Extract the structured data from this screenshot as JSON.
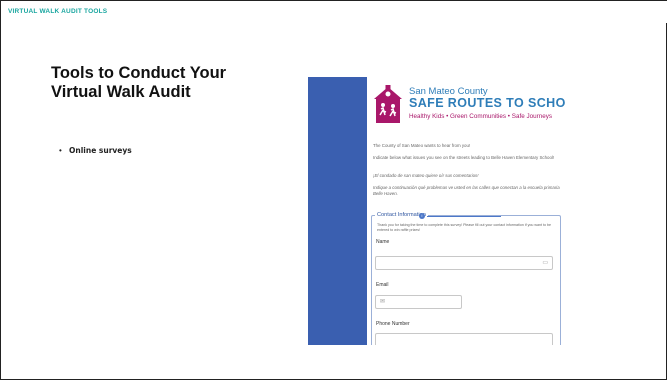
{
  "header": {
    "label": "VIRTUAL WALK AUDIT TOOLS"
  },
  "slide": {
    "title": "Tools to Conduct Your Virtual Walk Audit",
    "bullets": [
      {
        "marker": "•",
        "text": "Online surveys"
      }
    ]
  },
  "screenshot": {
    "brand": {
      "county": "San Mateo County",
      "program": "SAFE ROUTES TO SCHOOL",
      "tagline": "Healthy Kids • Green Communities • Safe Journeys"
    },
    "intro": [
      "The County of San Mateo wants to hear from you!",
      "Indicate below what issues you see on the streets leading to Belle Haven Elementary School!",
      "¡El condado de san mateo quiere oír sus comentarios!",
      "Indique a continuación qué problemas ve usted en las calles que conectan a la escuela primaria Belle Haven."
    ],
    "section": {
      "title": "Contact Information",
      "help_icon": "info-icon",
      "help": "Thank you for taking the time to complete this survey! Please fill out your contact information if you want to be entered to win raffle prizes!"
    },
    "fields": {
      "name_label": "Name",
      "email_label": "Email",
      "phone_label": "Phone Number"
    },
    "colors": {
      "background": "#3a5fb0",
      "brand_blue": "#2e7db8",
      "tagline_magenta": "#a9176a",
      "section_blue": "#2f56a0",
      "header_teal": "#1aa6a0"
    }
  }
}
